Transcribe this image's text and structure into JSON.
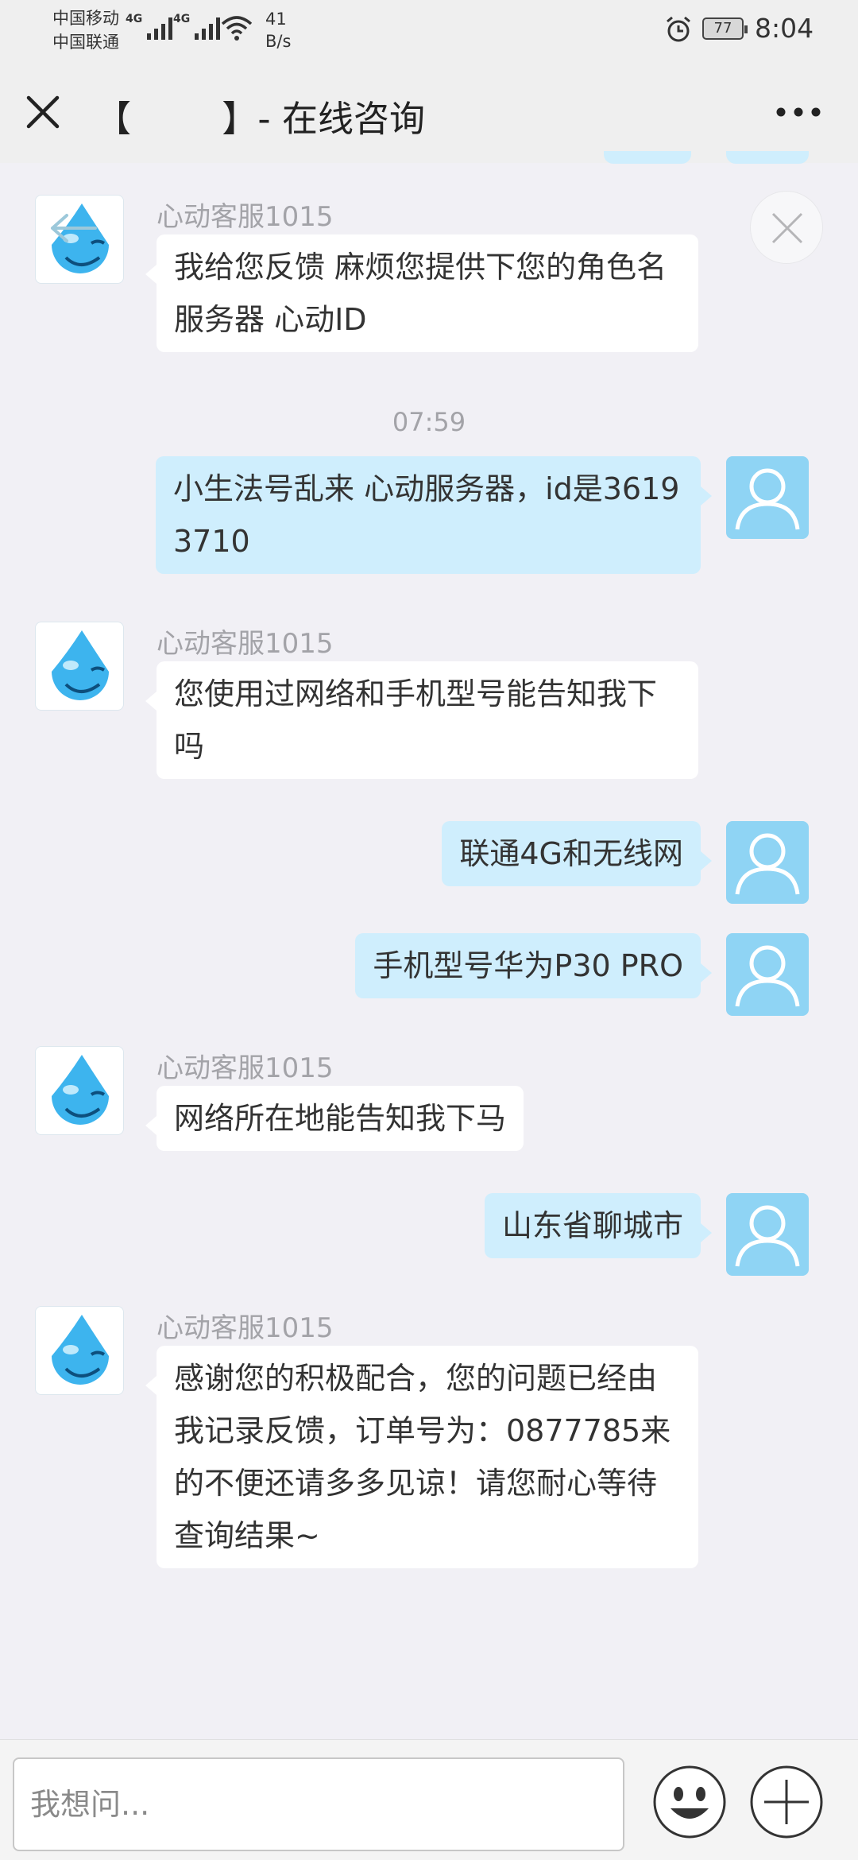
{
  "status_bar": {
    "carrier_1": "中国移动",
    "carrier_2": "中国联通",
    "network_1": "4G",
    "network_2": "4G",
    "speed_value": "41",
    "speed_unit": "B/s",
    "battery": "77",
    "time": "8:04"
  },
  "header": {
    "title": "【        】- 在线咨询"
  },
  "messages": [
    {
      "from": "cs",
      "sender": "心动客服1015",
      "text": "我给您反馈 麻烦您提供下您的角色名 服务器 心动ID"
    },
    {
      "timestamp": "07:59"
    },
    {
      "from": "user",
      "text": "小生法号乱来 心动服务器，id是36193710"
    },
    {
      "from": "cs",
      "sender": "心动客服1015",
      "text": "您使用过网络和手机型号能告知我下吗"
    },
    {
      "from": "user",
      "text": "联通4G和无线网"
    },
    {
      "from": "user",
      "text": "手机型号华为P30 PRO"
    },
    {
      "from": "cs",
      "sender": "心动客服1015",
      "text": "网络所在地能告知我下马"
    },
    {
      "from": "user",
      "text": "山东省聊城市"
    },
    {
      "from": "cs",
      "sender": "心动客服1015",
      "text": "感谢您的积极配合，您的问题已经由我记录反馈，订单号为：0877785来的不便还请多多见谅！请您耐心等待查询结果~"
    }
  ],
  "input": {
    "placeholder": "我想问..."
  },
  "icons": {
    "close": "close-icon",
    "more": "more-icon",
    "emoji": "emoji-icon",
    "add": "plus-icon",
    "cs_avatar": "smiley-drop-avatar",
    "user_avatar": "user-silhouette-avatar"
  },
  "colors": {
    "background": "#f1f0f5",
    "incoming_bubble": "#ffffff",
    "outgoing_bubble": "#cfeefd",
    "user_avatar": "#8fd4f4",
    "header": "#efefef"
  }
}
